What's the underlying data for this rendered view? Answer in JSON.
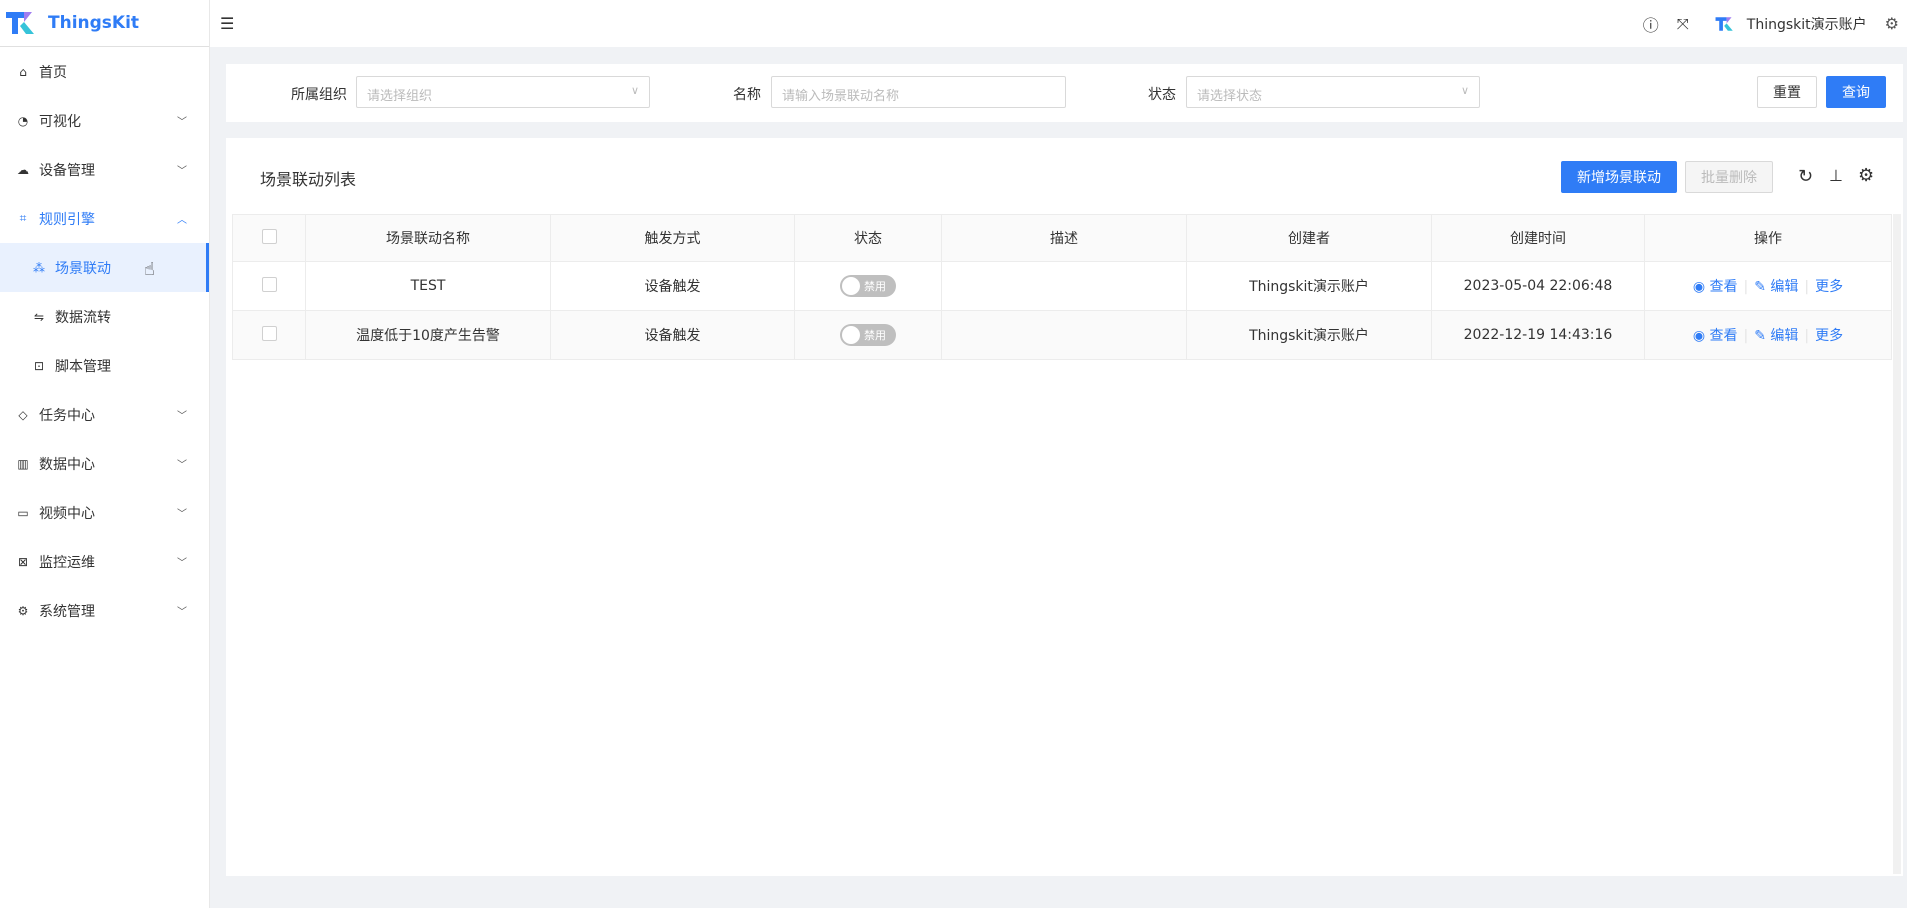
{
  "app": {
    "name": "ThingsKit"
  },
  "sidebar": {
    "items": [
      {
        "label": "首页",
        "icon": "home-icon"
      },
      {
        "label": "可视化",
        "icon": "dashboard-icon"
      },
      {
        "label": "设备管理",
        "icon": "device-icon"
      },
      {
        "label": "规则引擎",
        "icon": "rule-icon"
      },
      {
        "label": "场景联动",
        "icon": "scene-icon"
      },
      {
        "label": "数据流转",
        "icon": "flow-icon"
      },
      {
        "label": "脚本管理",
        "icon": "terminal-icon"
      },
      {
        "label": "任务中心",
        "icon": "tag-icon"
      },
      {
        "label": "数据中心",
        "icon": "chart-icon"
      },
      {
        "label": "视频中心",
        "icon": "video-icon"
      },
      {
        "label": "监控运维",
        "icon": "monitor-icon"
      },
      {
        "label": "系统管理",
        "icon": "gear-icon"
      }
    ]
  },
  "header": {
    "user": "Thingskit演示账户"
  },
  "filter": {
    "org_label": "所属组织",
    "org_placeholder": "请选择组织",
    "name_label": "名称",
    "name_placeholder": "请输入场景联动名称",
    "status_label": "状态",
    "status_placeholder": "请选择状态",
    "reset": "重置",
    "query": "查询"
  },
  "table": {
    "title": "场景联动列表",
    "add": "新增场景联动",
    "batch_delete": "批量删除",
    "columns": [
      "场景联动名称",
      "触发方式",
      "状态",
      "描述",
      "创建者",
      "创建时间",
      "操作"
    ],
    "rows": [
      {
        "name": "TEST",
        "trigger": "设备触发",
        "status": "禁用",
        "desc": "",
        "creator": "Thingskit演示账户",
        "time": "2023-05-04 22:06:48"
      },
      {
        "name": "温度低于10度产生告警",
        "trigger": "设备触发",
        "status": "禁用",
        "desc": "",
        "creator": "Thingskit演示账户",
        "time": "2022-12-19 14:43:16"
      }
    ],
    "actions": {
      "view": "查看",
      "edit": "编辑",
      "more": "更多"
    }
  },
  "colors": {
    "primary": "#2f7cf6"
  }
}
